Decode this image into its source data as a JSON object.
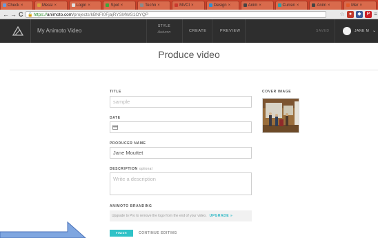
{
  "browser": {
    "tabs": [
      {
        "label": "Check",
        "fav": "#6a9ad8"
      },
      {
        "label": "Messi",
        "fav": "#d9a13a"
      },
      {
        "label": "Login",
        "fav": "#e0e0e0"
      },
      {
        "label": "Spot",
        "fav": "#3aa83a"
      },
      {
        "label": "Techn",
        "fav": "#8a8a8a"
      },
      {
        "label": "MVCI",
        "fav": "#c9392e"
      },
      {
        "label": "Design",
        "fav": "#2e8fd0"
      },
      {
        "label": "Anim",
        "fav": "#444444"
      },
      {
        "label": "Curren",
        "fav": "#2aa0a8"
      },
      {
        "label": "Anim",
        "fav": "#444444"
      },
      {
        "label": "Mer",
        "fav": "#e05a2a"
      }
    ],
    "url": {
      "scheme": "https://",
      "host": "animoto.com",
      "path": "/projects/kBNFI0FjajRYSMWS1OYQP"
    },
    "back_icon": "←",
    "forward_icon": "→",
    "reload_icon": "C"
  },
  "header": {
    "project_title": "My Animoto Video",
    "style_label": "STYLE",
    "style_value": "Autumn",
    "create": "CREATE",
    "preview": "PREVIEW",
    "saved": "SAVED",
    "user_name": "JANE M"
  },
  "page": {
    "title": "Produce video"
  },
  "form": {
    "title_label": "TITLE",
    "title_placeholder": "sample",
    "date_label": "DATE",
    "producer_label": "PRODUCER NAME",
    "producer_value": "Jane Mouttet",
    "description_label": "DESCRIPTION",
    "description_optional": "optional",
    "description_placeholder": "Write a description",
    "branding_label": "ANIMOTO BRANDING",
    "branding_text": "Upgrade to Pro to remove the logo from the end of your video.",
    "upgrade": "UPGRADE »",
    "finish": "FINISH",
    "continue": "CONTINUE EDITING"
  },
  "cover": {
    "label": "COVER IMAGE"
  },
  "colors": {
    "header_bg": "#2e2e2e",
    "accent": "#2fc2c7",
    "tabstrip": "#c9422b"
  }
}
